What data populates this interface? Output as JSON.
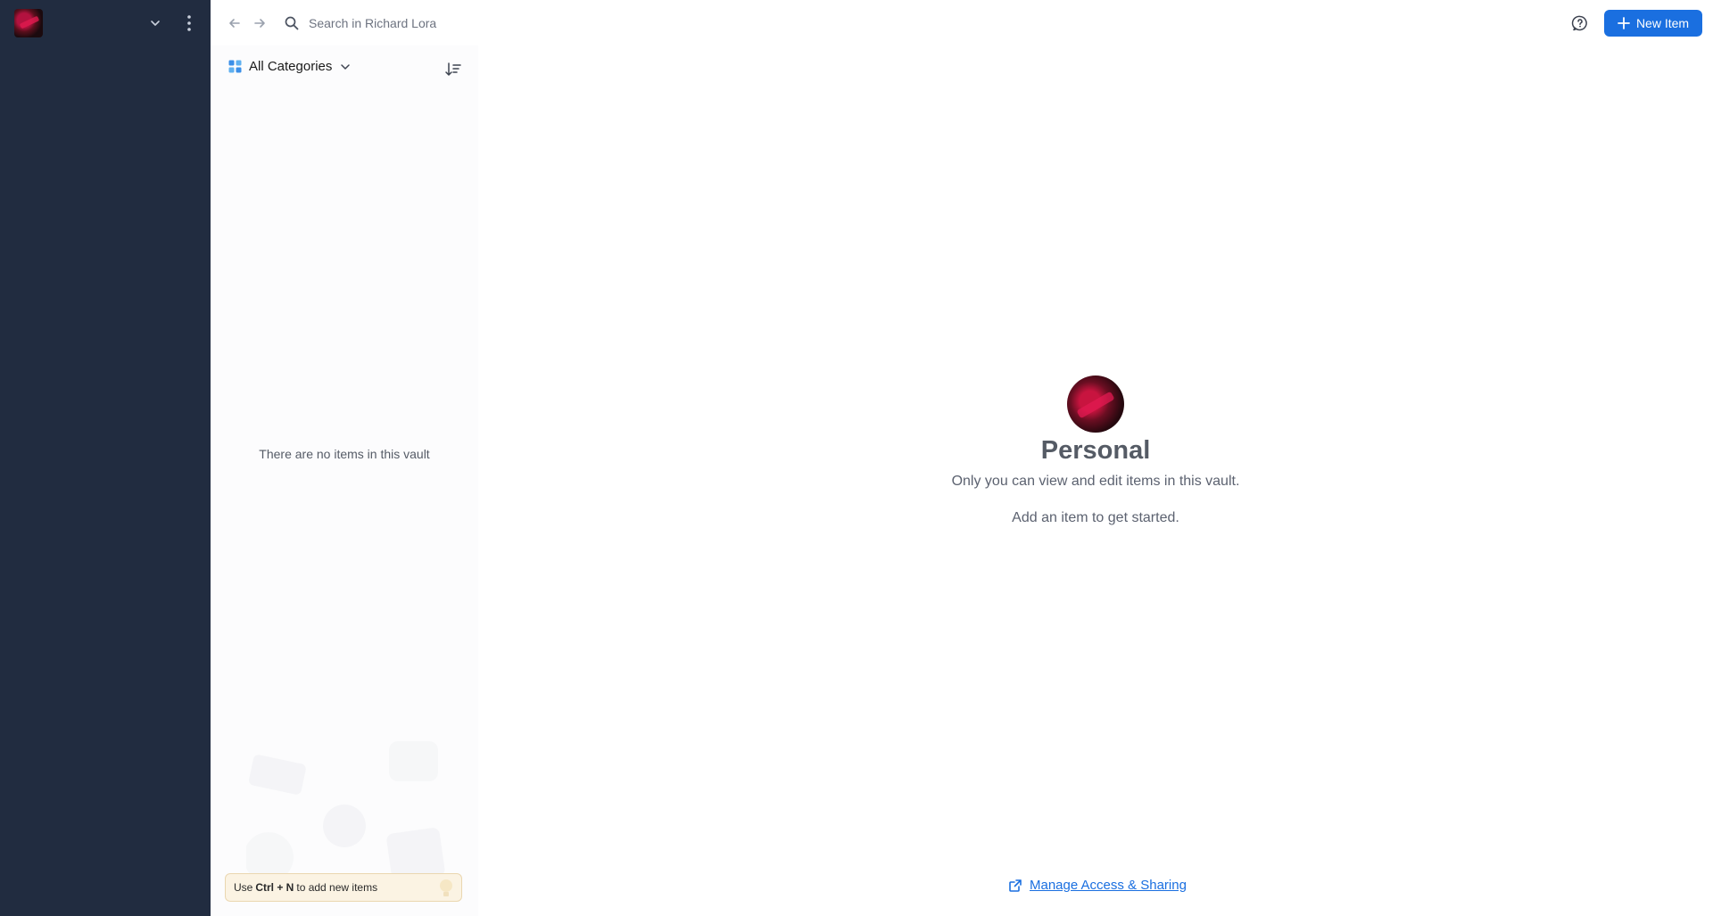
{
  "sidebar": {
    "account_avatar": "account-avatar",
    "icons": {
      "chevron": "chevron-down-icon",
      "more": "more-vertical-icon"
    }
  },
  "topbar": {
    "search_placeholder": "Search in Richard Lora",
    "new_item_label": "New Item",
    "icons": [
      "back-arrow-icon",
      "forward-arrow-icon",
      "search-icon",
      "help-icon",
      "plus-icon"
    ]
  },
  "list": {
    "categories_label": "All Categories",
    "empty_message": "There are no items in this vault",
    "tip": {
      "prefix": "Use ",
      "shortcut": "Ctrl + N",
      "suffix": " to add new items"
    }
  },
  "vault": {
    "title": "Personal",
    "description": "Only you can view and edit items in this vault.",
    "hint": "Add an item to get started.",
    "manage_link": "Manage Access & Sharing"
  },
  "colors": {
    "sidebar_bg": "#212c40",
    "accent": "#1a6fe0",
    "tip_bg": "#fbf3e3"
  }
}
